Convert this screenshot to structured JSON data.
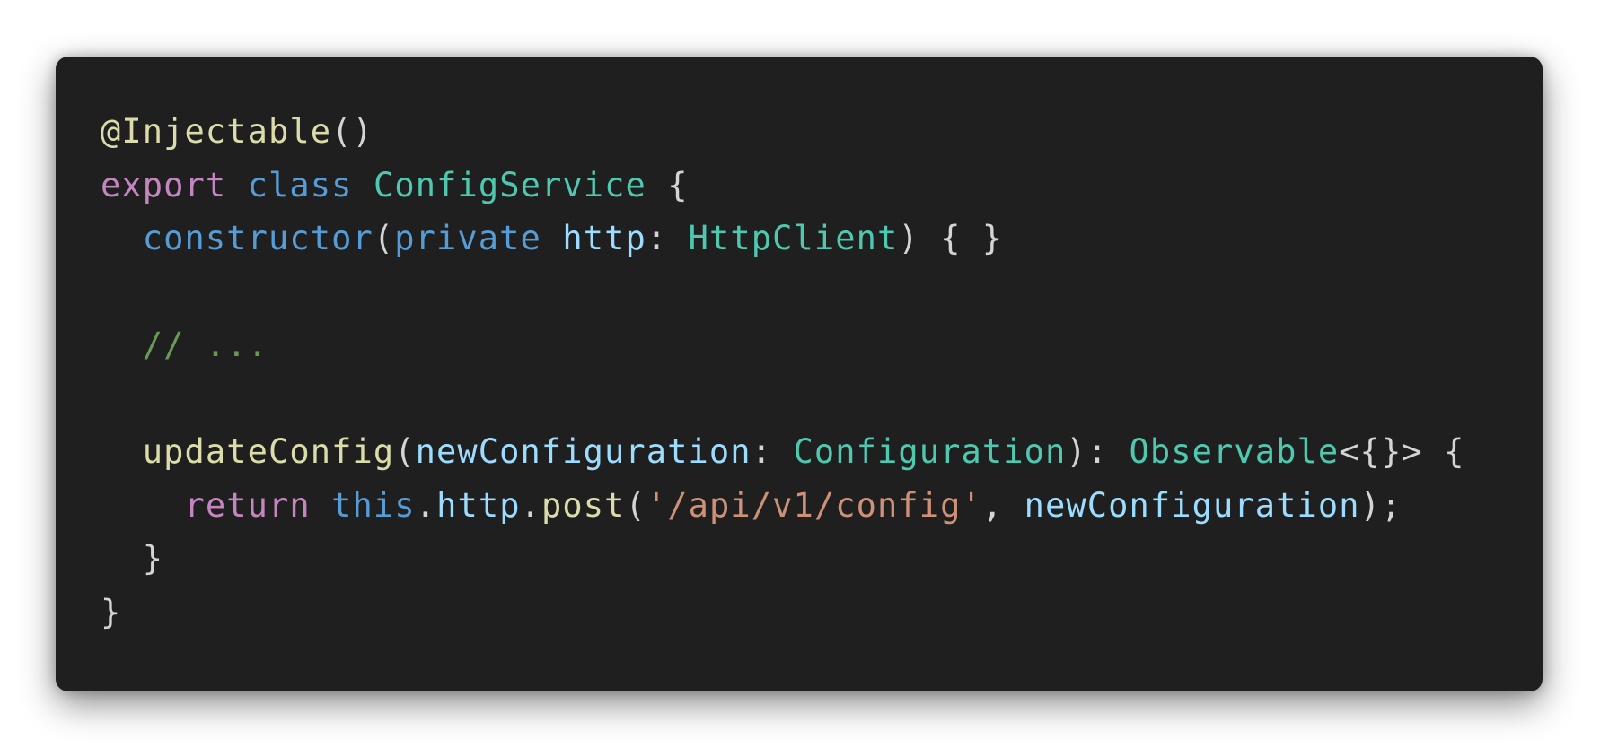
{
  "code": {
    "colors": {
      "background": "#1f1f1f",
      "plain": "#d4d4d4",
      "keyword": "#c586c0",
      "storage": "#569cd6",
      "type": "#4ec9b0",
      "function": "#dcdcaa",
      "variable": "#9cdcfe",
      "string": "#ce9178",
      "comment": "#6a9955"
    },
    "lines": [
      [
        {
          "text": "@Injectable",
          "color": "#dcdcaa"
        },
        {
          "text": "()",
          "color": "#d4d4d4"
        }
      ],
      [
        {
          "text": "export",
          "color": "#c586c0"
        },
        {
          "text": " ",
          "color": "#d4d4d4"
        },
        {
          "text": "class",
          "color": "#569cd6"
        },
        {
          "text": " ",
          "color": "#d4d4d4"
        },
        {
          "text": "ConfigService",
          "color": "#4ec9b0"
        },
        {
          "text": " {",
          "color": "#d4d4d4"
        }
      ],
      [
        {
          "text": "  ",
          "color": "#d4d4d4"
        },
        {
          "text": "constructor",
          "color": "#569cd6"
        },
        {
          "text": "(",
          "color": "#d4d4d4"
        },
        {
          "text": "private",
          "color": "#569cd6"
        },
        {
          "text": " ",
          "color": "#d4d4d4"
        },
        {
          "text": "http",
          "color": "#9cdcfe"
        },
        {
          "text": ": ",
          "color": "#d4d4d4"
        },
        {
          "text": "HttpClient",
          "color": "#4ec9b0"
        },
        {
          "text": ") { }",
          "color": "#d4d4d4"
        }
      ],
      [],
      [
        {
          "text": "  ",
          "color": "#d4d4d4"
        },
        {
          "text": "// ...",
          "color": "#6a9955"
        }
      ],
      [],
      [
        {
          "text": "  ",
          "color": "#d4d4d4"
        },
        {
          "text": "updateConfig",
          "color": "#dcdcaa"
        },
        {
          "text": "(",
          "color": "#d4d4d4"
        },
        {
          "text": "newConfiguration",
          "color": "#9cdcfe"
        },
        {
          "text": ": ",
          "color": "#d4d4d4"
        },
        {
          "text": "Configuration",
          "color": "#4ec9b0"
        },
        {
          "text": "): ",
          "color": "#d4d4d4"
        },
        {
          "text": "Observable",
          "color": "#4ec9b0"
        },
        {
          "text": "<{}> {",
          "color": "#d4d4d4"
        }
      ],
      [
        {
          "text": "    ",
          "color": "#d4d4d4"
        },
        {
          "text": "return",
          "color": "#c586c0"
        },
        {
          "text": " ",
          "color": "#d4d4d4"
        },
        {
          "text": "this",
          "color": "#569cd6"
        },
        {
          "text": ".",
          "color": "#d4d4d4"
        },
        {
          "text": "http",
          "color": "#9cdcfe"
        },
        {
          "text": ".",
          "color": "#d4d4d4"
        },
        {
          "text": "post",
          "color": "#dcdcaa"
        },
        {
          "text": "(",
          "color": "#d4d4d4"
        },
        {
          "text": "'/api/v1/config'",
          "color": "#ce9178"
        },
        {
          "text": ", ",
          "color": "#d4d4d4"
        },
        {
          "text": "newConfiguration",
          "color": "#9cdcfe"
        },
        {
          "text": ");",
          "color": "#d4d4d4"
        }
      ],
      [
        {
          "text": "  }",
          "color": "#d4d4d4"
        }
      ],
      [
        {
          "text": "}",
          "color": "#d4d4d4"
        }
      ]
    ]
  }
}
